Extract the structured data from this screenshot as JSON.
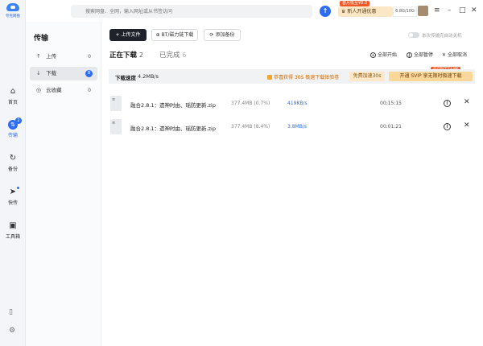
{
  "app": {
    "logo_text": "夸克网盘"
  },
  "rail": {
    "items": [
      {
        "label": "首页",
        "icon": "home-icon",
        "glyph": "⌂"
      },
      {
        "label": "传输",
        "icon": "transfer-icon",
        "glyph": "⇅",
        "badge": "2"
      },
      {
        "label": "备份",
        "icon": "backup-icon",
        "glyph": "↻"
      },
      {
        "label": "快传",
        "icon": "quick-send-icon",
        "glyph": "➤"
      },
      {
        "label": "工具箱",
        "icon": "toolbox-icon",
        "glyph": "▣"
      }
    ]
  },
  "sidebar": {
    "title": "传输",
    "items": [
      {
        "label": "上传",
        "glyph": "↑",
        "count": "0"
      },
      {
        "label": "下载",
        "glyph": "↓",
        "count": "8"
      },
      {
        "label": "云收藏",
        "glyph": "◎",
        "count": "0"
      }
    ]
  },
  "topbar": {
    "search_placeholder": "搜索网盘、全网，输入网址或从书签访问",
    "promo_tag": "首月低至¥8.8",
    "promo_text": "新人开通优惠",
    "storage": "6.8G/10G"
  },
  "toolbar": {
    "upload": "上传文件",
    "bt": "BT/磁力链下载",
    "backup": "添加备份",
    "shutdown_label": "本次传输完自动关机"
  },
  "tabs": {
    "downloading_label": "正在下载",
    "downloading_count": "2",
    "done_label": "已完成",
    "done_count": "6"
  },
  "actions": {
    "start_all": "全部开始",
    "pause_all": "全部暂停",
    "cancel_all": "全部取消"
  },
  "speedbar": {
    "label": "下载速度",
    "value": "4.2MB/s",
    "notice": "恭喜获得 30S 极速下载体验卷",
    "free_button": "免费加速30s",
    "svip_tag": "首月低至¥1.88",
    "svip_button": "开通 SVIP 享无限时极速下载"
  },
  "files": [
    {
      "icon_text": "≡",
      "name": "融合2.8.1：遗神时由、瑶防更新.zip",
      "size": "377.4MB (0.7%)",
      "speed": "419KB/s",
      "time": "00:15:15"
    },
    {
      "icon_text": "≡",
      "name": "融合2.8.1：遗神时由、瑶防更新.zip",
      "size": "377.4MB (8.4%)",
      "speed": "3.8MB/s",
      "time": "00:01:21"
    }
  ],
  "colors": {
    "accent": "#2d6df6",
    "sidebar_bg": "#fafbfc",
    "rail_bg": "#f3f5f8"
  }
}
